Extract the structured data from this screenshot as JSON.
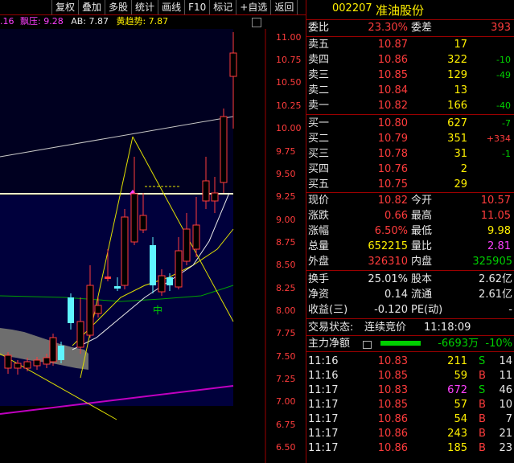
{
  "toolbar": {
    "buttons": [
      "复权",
      "叠加",
      "多股",
      "统计",
      "画线",
      "F10",
      "标记",
      "+自选",
      "返回"
    ]
  },
  "legend": {
    "cut": ".16",
    "piaoya": "飘压: 9.28",
    "ab": "AB: 7.87",
    "trend": "黄趋势: 7.87"
  },
  "chart": {
    "price_axis": [
      "11.00",
      "10.75",
      "10.50",
      "10.25",
      "10.00",
      "9.75",
      "9.50",
      "9.25",
      "9.00",
      "8.75",
      "8.50",
      "8.25",
      "8.00",
      "7.75",
      "7.50",
      "7.25",
      "7.00",
      "6.75",
      "6.50"
    ],
    "marker": "中",
    "colors": {
      "bg": "#000000",
      "panel": "#00003c",
      "up": "#ff3c3c",
      "down": "#5ff5ff"
    }
  },
  "quote": {
    "code": "002207",
    "name": "准油股份",
    "webi_label": "委比",
    "webi_value": "23.30%",
    "weicha_label": "委差",
    "weicha_value": "393",
    "asks": [
      {
        "label": "卖五",
        "price": "10.87",
        "vol": "17",
        "chg": ""
      },
      {
        "label": "卖四",
        "price": "10.86",
        "vol": "322",
        "chg": "-10"
      },
      {
        "label": "卖三",
        "price": "10.85",
        "vol": "129",
        "chg": "-49"
      },
      {
        "label": "卖二",
        "price": "10.84",
        "vol": "13",
        "chg": ""
      },
      {
        "label": "卖一",
        "price": "10.82",
        "vol": "166",
        "chg": "-40"
      }
    ],
    "bids": [
      {
        "label": "买一",
        "price": "10.80",
        "vol": "627",
        "chg": "-7"
      },
      {
        "label": "买二",
        "price": "10.79",
        "vol": "351",
        "chg": "+334"
      },
      {
        "label": "买三",
        "price": "10.78",
        "vol": "31",
        "chg": "-1"
      },
      {
        "label": "买四",
        "price": "10.76",
        "vol": "2",
        "chg": ""
      },
      {
        "label": "买五",
        "price": "10.75",
        "vol": "29",
        "chg": ""
      }
    ],
    "stats": [
      {
        "l1": "现价",
        "v1": "10.82",
        "l2": "今开",
        "v2": "10.57"
      },
      {
        "l1": "涨跌",
        "v1": "0.66",
        "l2": "最高",
        "v2": "11.05"
      },
      {
        "l1": "涨幅",
        "v1": "6.50%",
        "l2": "最低",
        "v2": "9.98"
      },
      {
        "l1": "总量",
        "v1": "652215",
        "l2": "量比",
        "v2": "2.81"
      },
      {
        "l1": "外盘",
        "v1": "326310",
        "l2": "内盘",
        "v2": "325905"
      }
    ],
    "fund": [
      {
        "l1": "换手",
        "v1": "25.01%",
        "l2": "股本",
        "v2": "2.62亿"
      },
      {
        "l1": "净资",
        "v1": "0.14",
        "l2": "流通",
        "v2": "2.61亿"
      },
      {
        "l1": "收益(三)",
        "v1": "-0.120",
        "l2": "PE(动)",
        "v2": "-"
      }
    ],
    "status_label": "交易状态:",
    "status_value": "连续竞价",
    "status_time": "11:18:09",
    "netflow_label": "主力净额",
    "netflow_value": "-6693万",
    "netflow_pct": "-10%",
    "ticks": [
      {
        "time": "11:16",
        "price": "10.83",
        "vol": "211",
        "side": "S",
        "n": "14"
      },
      {
        "time": "11:16",
        "price": "10.85",
        "vol": "59",
        "side": "B",
        "n": "11"
      },
      {
        "time": "11:17",
        "price": "10.83",
        "vol": "672",
        "side": "S",
        "n": "46"
      },
      {
        "time": "11:17",
        "price": "10.85",
        "vol": "57",
        "side": "B",
        "n": "10"
      },
      {
        "time": "11:17",
        "price": "10.86",
        "vol": "54",
        "side": "B",
        "n": "7"
      },
      {
        "time": "11:17",
        "price": "10.86",
        "vol": "243",
        "side": "B",
        "n": "21"
      },
      {
        "time": "11:17",
        "price": "10.86",
        "vol": "185",
        "side": "B",
        "n": "23"
      }
    ]
  }
}
